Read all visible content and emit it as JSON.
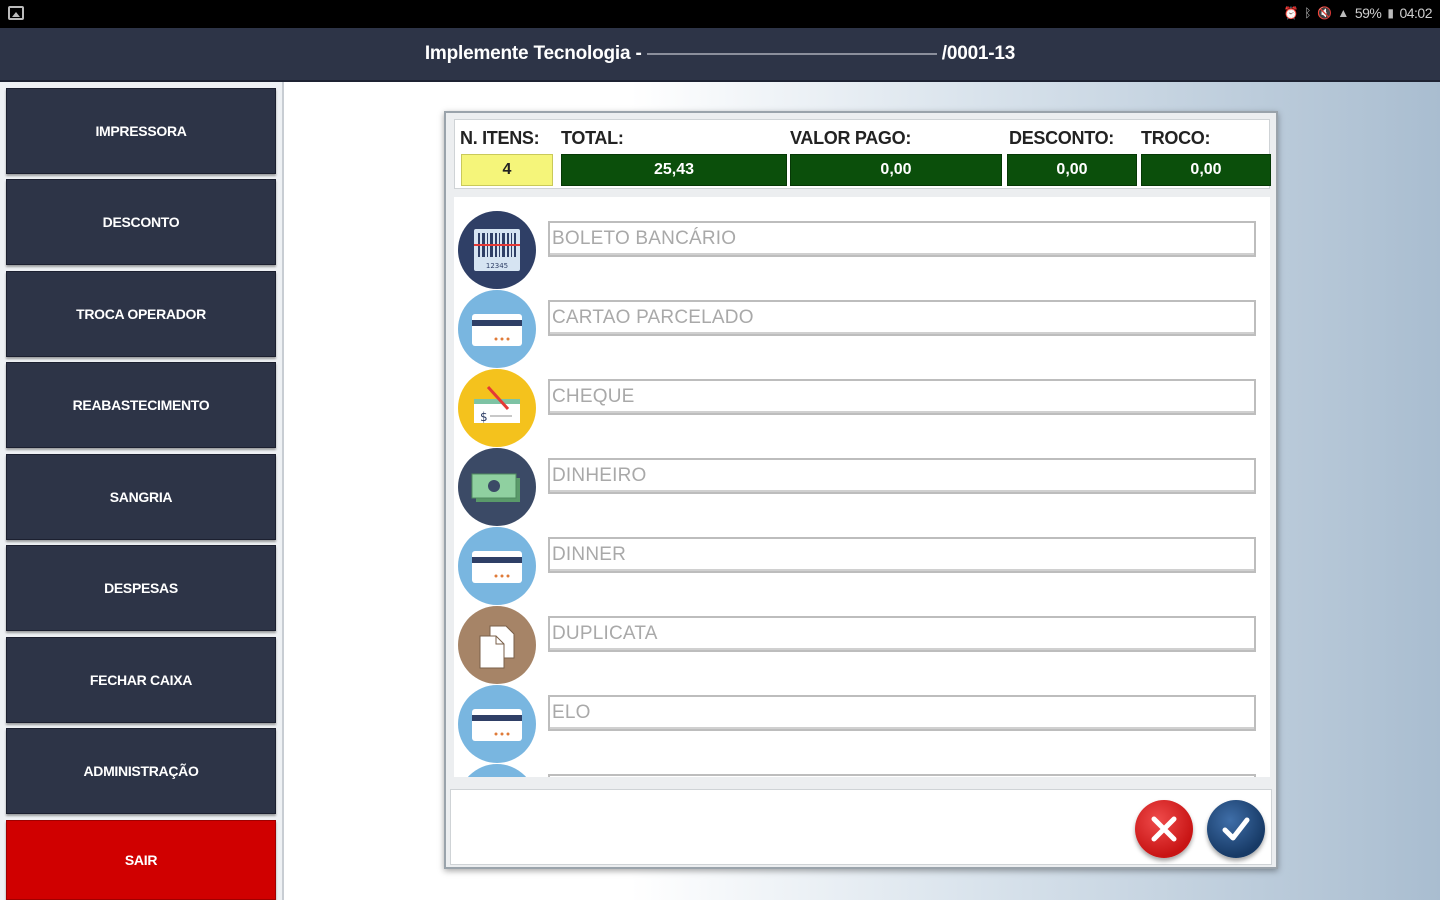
{
  "status_bar": {
    "battery": "59%",
    "time": "04:02"
  },
  "title": "Implemente Tecnologia - ",
  "title_suffix": "/0001-13",
  "sidebar": [
    {
      "label": "IMPRESSORA"
    },
    {
      "label": "DESCONTO"
    },
    {
      "label": "TROCA OPERADOR"
    },
    {
      "label": "REABASTECIMENTO"
    },
    {
      "label": "SANGRIA"
    },
    {
      "label": "DESPESAS"
    },
    {
      "label": "FECHAR CAIXA"
    },
    {
      "label": "ADMINISTRAÇÃO"
    },
    {
      "label": "SAIR"
    }
  ],
  "summary": {
    "n_itens_label": "N. ITENS:",
    "n_itens": "4",
    "total_label": "TOTAL:",
    "total": "25,43",
    "valor_pago_label": "VALOR PAGO:",
    "valor_pago": "0,00",
    "desconto_label": "DESCONTO:",
    "desconto": "0,00",
    "troco_label": "TROCO:",
    "troco": "0,00"
  },
  "payment_methods": [
    {
      "placeholder": "BOLETO BANCÁRIO",
      "icon": "barcode-icon",
      "color": "#2f3f66"
    },
    {
      "placeholder": "CARTAO PARCELADO",
      "icon": "credit-card-icon",
      "color": "#79b6e0"
    },
    {
      "placeholder": "CHEQUE",
      "icon": "cheque-icon",
      "color": "#f4c21d"
    },
    {
      "placeholder": "DINHEIRO",
      "icon": "cash-icon",
      "color": "#3b4a66"
    },
    {
      "placeholder": "DINNER",
      "icon": "credit-card-icon",
      "color": "#79b6e0"
    },
    {
      "placeholder": "DUPLICATA",
      "icon": "documents-icon",
      "color": "#a68467"
    },
    {
      "placeholder": "ELO",
      "icon": "credit-card-icon",
      "color": "#79b6e0"
    }
  ]
}
